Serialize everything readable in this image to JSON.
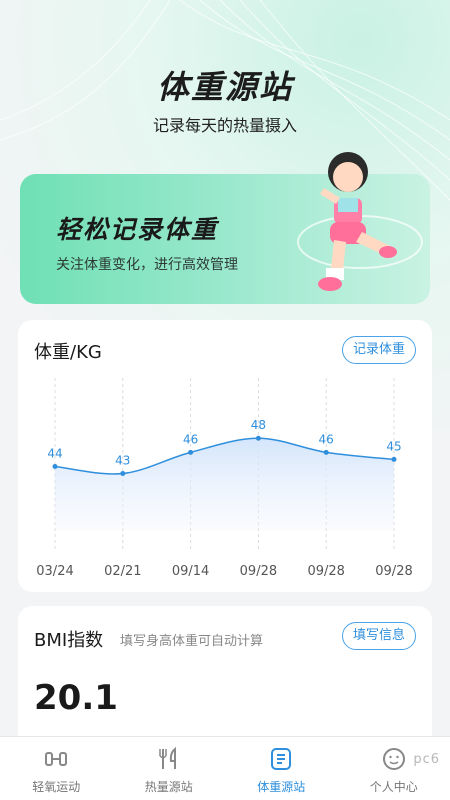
{
  "hero": {
    "title": "体重源站",
    "subtitle": "记录每天的热量摄入"
  },
  "banner": {
    "title": "轻松记录体重",
    "subtitle": "关注体重变化，进行高效管理"
  },
  "weight_card": {
    "title": "体重/KG",
    "record_button": "记录体重"
  },
  "chart_data": {
    "type": "area",
    "categories": [
      "03/24",
      "02/21",
      "09/14",
      "09/28",
      "09/28",
      "09/28"
    ],
    "values": [
      44,
      43,
      46,
      48,
      46,
      45
    ],
    "title": "体重/KG",
    "xlabel": "",
    "ylabel": "",
    "ylim": [
      35,
      52
    ],
    "grid": "vertical dashed",
    "color": "#2f8fdc"
  },
  "bmi_card": {
    "title": "BMI指数",
    "hint": "填写身高体重可自动计算",
    "fill_button": "填写信息",
    "value": "20.1"
  },
  "tabbar": {
    "items": [
      {
        "label": "轻氧运动",
        "icon": "dumbbell-icon"
      },
      {
        "label": "热量源站",
        "icon": "fork-knife-icon"
      },
      {
        "label": "体重源站",
        "icon": "list-icon",
        "active": true
      },
      {
        "label": "个人中心",
        "icon": "smiley-icon"
      }
    ]
  },
  "watermark": "pc6",
  "colors": {
    "accent": "#2f8fdc",
    "banner": "#6fe0b5"
  }
}
